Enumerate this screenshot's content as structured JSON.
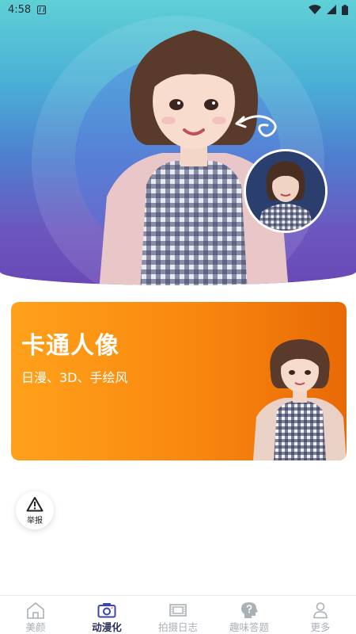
{
  "status_bar": {
    "time": "4:58",
    "notification_icon": "a-icon",
    "icons": [
      "wifi-icon",
      "signal-icon",
      "battery-icon"
    ]
  },
  "hero": {
    "main_image": "cartoon-portrait-girl",
    "original_photo": "real-photo-girl",
    "arrow_icon": "curved-arrow-icon"
  },
  "feature_card": {
    "title": "卡通人像",
    "subtitle": "日漫、3D、手绘风",
    "colors": {
      "start": "#ffa11a",
      "end": "#e86a06"
    }
  },
  "report_button": {
    "label": "举报",
    "icon": "warning-triangle-icon"
  },
  "tab_bar": {
    "active_index": 1,
    "active_color": "#2b2f5c",
    "inactive_color": "#a9b0b6",
    "tabs": [
      {
        "label": "美颜",
        "icon": "home-icon"
      },
      {
        "label": "动漫化",
        "icon": "camera-icon"
      },
      {
        "label": "拍摄日志",
        "icon": "film-frame-icon"
      },
      {
        "label": "趣味答题",
        "icon": "head-question-icon"
      },
      {
        "label": "更多",
        "icon": "person-icon"
      }
    ]
  }
}
